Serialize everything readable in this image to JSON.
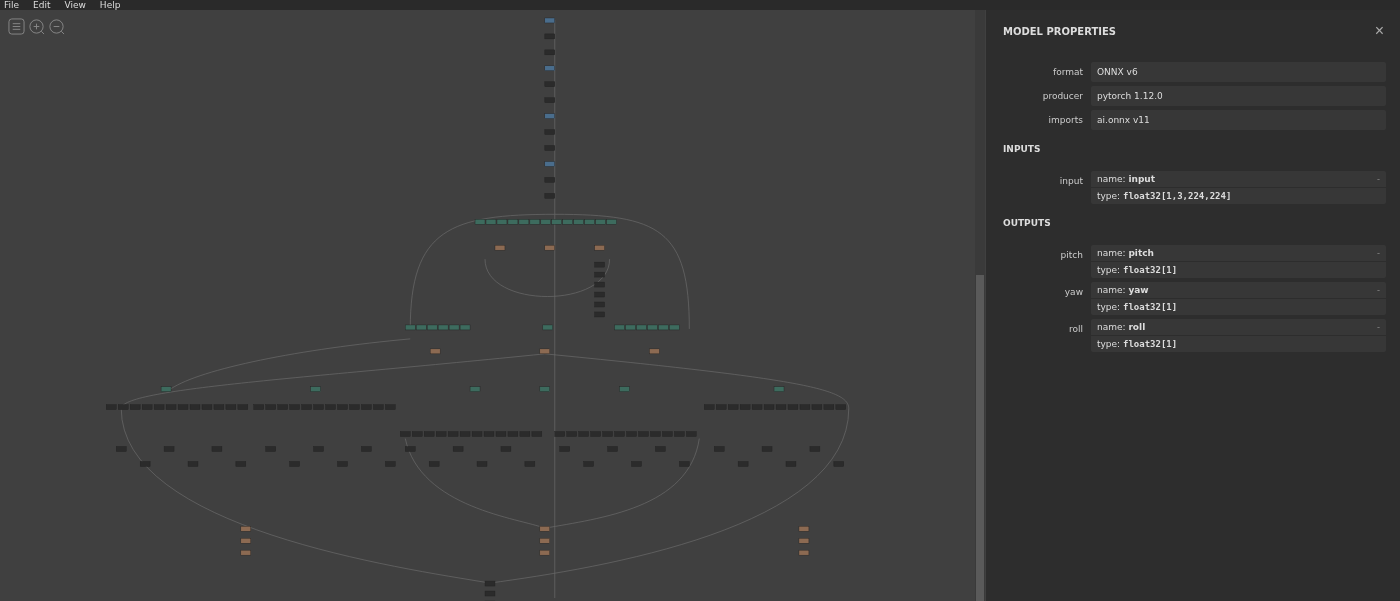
{
  "menu": [
    "File",
    "Edit",
    "View",
    "Help"
  ],
  "panel": {
    "title": "MODEL PROPERTIES",
    "close": "×",
    "properties": [
      {
        "label": "format",
        "value": "ONNX v6"
      },
      {
        "label": "producer",
        "value": "pytorch 1.12.0"
      },
      {
        "label": "imports",
        "value": "ai.onnx v11"
      }
    ],
    "sections": [
      {
        "title": "INPUTS",
        "items": [
          {
            "label": "input",
            "name_key": "name: ",
            "name": "input",
            "type_key": "type: ",
            "type": "float32[1,3,224,224]",
            "toggle": "-"
          }
        ]
      },
      {
        "title": "OUTPUTS",
        "items": [
          {
            "label": "pitch",
            "name_key": "name: ",
            "name": "pitch",
            "type_key": "type: ",
            "type": "float32[1]",
            "toggle": "-"
          },
          {
            "label": "yaw",
            "name_key": "name: ",
            "name": "yaw",
            "type_key": "type: ",
            "type": "float32[1]",
            "toggle": "-"
          },
          {
            "label": "roll",
            "name_key": "name: ",
            "name": "roll",
            "type_key": "type: ",
            "type": "float32[1]",
            "toggle": "-"
          }
        ]
      }
    ]
  }
}
